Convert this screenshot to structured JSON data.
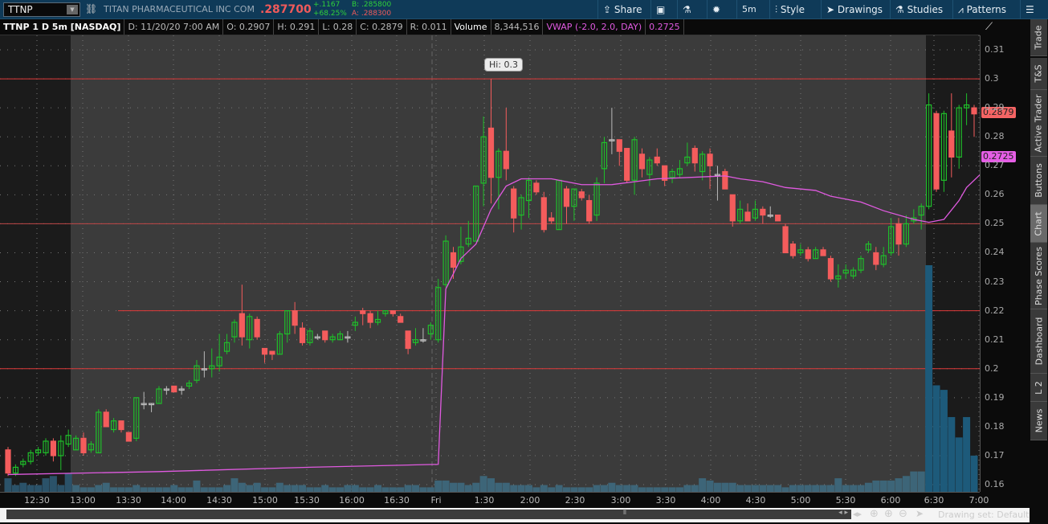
{
  "header": {
    "symbol": "TTNP",
    "company": "TITAN PHARMACEUTICAL INC COM",
    "last": ".287700",
    "change": "+.1167",
    "change_pct": "+68.25%",
    "bid": "B: .285800",
    "ask": "A: .288300",
    "buttons": {
      "share": "Share",
      "timeframe": "5m",
      "style": "Style",
      "drawings": "Drawings",
      "studies": "Studies",
      "patterns": "Patterns"
    }
  },
  "info": {
    "title": "TTNP 1 D 5m [NASDAQ]",
    "date": "D: 11/20/20 7:00 AM",
    "open": "O: 0.2907",
    "high": "H: 0.291",
    "low": "L: 0.28",
    "close": "C: 0.2879",
    "range": "R: 0.011",
    "volume_label": "Volume",
    "volume": "8,344,516",
    "vwap_label": "VWAP (-2.0, 2.0, DAY)",
    "vwap": "0.2725"
  },
  "price_tags": {
    "last": "0.2879",
    "vwap": "0.2725"
  },
  "hi_label": "Hi: 0.3",
  "sidebar": [
    "Trade",
    "T&S",
    "Active Trader",
    "Buttons",
    "Chart",
    "Phase Scores",
    "Dashboard",
    "L 2",
    "News"
  ],
  "sidebar_selected": "Chart",
  "footer": {
    "drawing_set": "Drawing set: Default"
  },
  "colors": {
    "up": "#1fbf2a",
    "down": "#f45c5c",
    "vwap": "#e05ae0",
    "level": "#e03a3a"
  },
  "chart_data": {
    "type": "candlestick",
    "symbol": "TTNP",
    "interval": "5m",
    "ylim": [
      0.155,
      0.3165
    ],
    "y_ticks": [
      "0.31",
      "0.3",
      "0.29",
      "0.28",
      "0.27",
      "0.26",
      "0.25",
      "0.24",
      "0.23",
      "0.22",
      "0.21",
      "0.2",
      "0.19",
      "0.18",
      "0.17",
      "0.16"
    ],
    "x_ticks": [
      "12:30",
      "13:00",
      "13:30",
      "14:00",
      "14:30",
      "15:00",
      "15:30",
      "16:00",
      "16:30",
      "Fri",
      "1:30",
      "2:00",
      "2:30",
      "3:00",
      "3:30",
      "4:00",
      "4:30",
      "5:00",
      "5:30",
      "6:00",
      "6:30",
      "7:00"
    ],
    "levels": [
      0.3,
      0.25,
      0.22,
      0.2
    ],
    "ohlc": [
      [
        0.172,
        0.173,
        0.163,
        0.164
      ],
      [
        0.164,
        0.167,
        0.163,
        0.166
      ],
      [
        0.167,
        0.169,
        0.166,
        0.168
      ],
      [
        0.168,
        0.172,
        0.167,
        0.171
      ],
      [
        0.171,
        0.173,
        0.17,
        0.172
      ],
      [
        0.171,
        0.176,
        0.17,
        0.175
      ],
      [
        0.175,
        0.176,
        0.168,
        0.17
      ],
      [
        0.17,
        0.177,
        0.165,
        0.175
      ],
      [
        0.174,
        0.179,
        0.173,
        0.177
      ],
      [
        0.172,
        0.177,
        0.172,
        0.176
      ],
      [
        0.176,
        0.178,
        0.17,
        0.171
      ],
      [
        0.172,
        0.175,
        0.171,
        0.174
      ],
      [
        0.171,
        0.186,
        0.171,
        0.185
      ],
      [
        0.185,
        0.186,
        0.18,
        0.18
      ],
      [
        0.179,
        0.183,
        0.178,
        0.182
      ],
      [
        0.182,
        0.182,
        0.178,
        0.179
      ],
      [
        0.178,
        0.178,
        0.175,
        0.175
      ],
      [
        0.176,
        0.19,
        0.175,
        0.19
      ],
      [
        0.188,
        0.192,
        0.186,
        0.188
      ],
      [
        0.188,
        0.188,
        0.185,
        0.188
      ],
      [
        0.188,
        0.194,
        0.188,
        0.193
      ],
      [
        0.193,
        0.194,
        0.191,
        0.193
      ],
      [
        0.194,
        0.194,
        0.192,
        0.192
      ],
      [
        0.193,
        0.194,
        0.191,
        0.193
      ],
      [
        0.194,
        0.196,
        0.193,
        0.195
      ],
      [
        0.196,
        0.203,
        0.195,
        0.201
      ],
      [
        0.2,
        0.206,
        0.197,
        0.2
      ],
      [
        0.2,
        0.207,
        0.197,
        0.201
      ],
      [
        0.201,
        0.212,
        0.199,
        0.204
      ],
      [
        0.206,
        0.212,
        0.205,
        0.209
      ],
      [
        0.211,
        0.217,
        0.209,
        0.216
      ],
      [
        0.219,
        0.229,
        0.208,
        0.211
      ],
      [
        0.21,
        0.219,
        0.207,
        0.218
      ],
      [
        0.217,
        0.218,
        0.21,
        0.211
      ],
      [
        0.207,
        0.207,
        0.202,
        0.205
      ],
      [
        0.206,
        0.206,
        0.203,
        0.205
      ],
      [
        0.205,
        0.213,
        0.205,
        0.212
      ],
      [
        0.212,
        0.22,
        0.209,
        0.22
      ],
      [
        0.22,
        0.223,
        0.212,
        0.215
      ],
      [
        0.214,
        0.216,
        0.208,
        0.209
      ],
      [
        0.209,
        0.214,
        0.208,
        0.213
      ],
      [
        0.211,
        0.212,
        0.21,
        0.211
      ],
      [
        0.213,
        0.213,
        0.209,
        0.21
      ],
      [
        0.21,
        0.212,
        0.209,
        0.211
      ],
      [
        0.21,
        0.213,
        0.21,
        0.212
      ],
      [
        0.211,
        0.213,
        0.209,
        0.211
      ],
      [
        0.215,
        0.218,
        0.213,
        0.216
      ],
      [
        0.22,
        0.221,
        0.215,
        0.219
      ],
      [
        0.219,
        0.22,
        0.214,
        0.216
      ],
      [
        0.216,
        0.22,
        0.215,
        0.217
      ],
      [
        0.219,
        0.22,
        0.218,
        0.22
      ],
      [
        0.22,
        0.22,
        0.218,
        0.219
      ],
      [
        0.218,
        0.219,
        0.216,
        0.216
      ],
      [
        0.213,
        0.213,
        0.205,
        0.207
      ],
      [
        0.209,
        0.214,
        0.208,
        0.21
      ],
      [
        0.21,
        0.214,
        0.209,
        0.21
      ],
      [
        0.212,
        0.216,
        0.21,
        0.215
      ],
      [
        0.21,
        0.231,
        0.209,
        0.228
      ],
      [
        0.229,
        0.246,
        0.228,
        0.244
      ],
      [
        0.24,
        0.242,
        0.231,
        0.235
      ],
      [
        0.237,
        0.249,
        0.236,
        0.242
      ],
      [
        0.243,
        0.251,
        0.242,
        0.245
      ],
      [
        0.244,
        0.263,
        0.244,
        0.263
      ],
      [
        0.264,
        0.287,
        0.256,
        0.28
      ],
      [
        0.283,
        0.3,
        0.257,
        0.266
      ],
      [
        0.266,
        0.276,
        0.255,
        0.275
      ],
      [
        0.275,
        0.29,
        0.265,
        0.269
      ],
      [
        0.262,
        0.263,
        0.247,
        0.252
      ],
      [
        0.253,
        0.26,
        0.248,
        0.259
      ],
      [
        0.258,
        0.266,
        0.252,
        0.265
      ],
      [
        0.264,
        0.265,
        0.26,
        0.261
      ],
      [
        0.259,
        0.261,
        0.247,
        0.248
      ],
      [
        0.252,
        0.254,
        0.25,
        0.251
      ],
      [
        0.248,
        0.265,
        0.248,
        0.265
      ],
      [
        0.262,
        0.263,
        0.25,
        0.256
      ],
      [
        0.256,
        0.262,
        0.251,
        0.262
      ],
      [
        0.261,
        0.262,
        0.258,
        0.259
      ],
      [
        0.258,
        0.26,
        0.25,
        0.251
      ],
      [
        0.253,
        0.266,
        0.251,
        0.264
      ],
      [
        0.269,
        0.28,
        0.264,
        0.278
      ],
      [
        0.279,
        0.29,
        0.274,
        0.279
      ],
      [
        0.279,
        0.279,
        0.27,
        0.275
      ],
      [
        0.276,
        0.276,
        0.264,
        0.265
      ],
      [
        0.265,
        0.28,
        0.26,
        0.279
      ],
      [
        0.274,
        0.276,
        0.266,
        0.269
      ],
      [
        0.267,
        0.273,
        0.263,
        0.272
      ],
      [
        0.273,
        0.276,
        0.27,
        0.271
      ],
      [
        0.27,
        0.27,
        0.263,
        0.265
      ],
      [
        0.266,
        0.269,
        0.264,
        0.268
      ],
      [
        0.267,
        0.272,
        0.266,
        0.269
      ],
      [
        0.271,
        0.278,
        0.27,
        0.273
      ],
      [
        0.276,
        0.277,
        0.268,
        0.271
      ],
      [
        0.268,
        0.275,
        0.265,
        0.274
      ],
      [
        0.274,
        0.276,
        0.262,
        0.27
      ],
      [
        0.267,
        0.27,
        0.258,
        0.267
      ],
      [
        0.268,
        0.269,
        0.262,
        0.262
      ],
      [
        0.26,
        0.26,
        0.249,
        0.251
      ],
      [
        0.251,
        0.258,
        0.25,
        0.255
      ],
      [
        0.254,
        0.257,
        0.251,
        0.251
      ],
      [
        0.252,
        0.258,
        0.251,
        0.255
      ],
      [
        0.255,
        0.256,
        0.25,
        0.253
      ],
      [
        0.253,
        0.256,
        0.252,
        0.253
      ],
      [
        0.253,
        0.253,
        0.251,
        0.251
      ],
      [
        0.249,
        0.25,
        0.24,
        0.24
      ],
      [
        0.243,
        0.244,
        0.238,
        0.239
      ],
      [
        0.24,
        0.243,
        0.239,
        0.241
      ],
      [
        0.241,
        0.242,
        0.237,
        0.238
      ],
      [
        0.238,
        0.242,
        0.238,
        0.241
      ],
      [
        0.241,
        0.242,
        0.239,
        0.239
      ],
      [
        0.238,
        0.239,
        0.23,
        0.231
      ],
      [
        0.231,
        0.236,
        0.228,
        0.232
      ],
      [
        0.233,
        0.236,
        0.231,
        0.234
      ],
      [
        0.232,
        0.235,
        0.231,
        0.234
      ],
      [
        0.234,
        0.239,
        0.233,
        0.238
      ],
      [
        0.241,
        0.244,
        0.24,
        0.243
      ],
      [
        0.24,
        0.242,
        0.234,
        0.236
      ],
      [
        0.236,
        0.242,
        0.235,
        0.239
      ],
      [
        0.24,
        0.252,
        0.239,
        0.249
      ],
      [
        0.25,
        0.252,
        0.239,
        0.243
      ],
      [
        0.243,
        0.253,
        0.242,
        0.25
      ],
      [
        0.251,
        0.255,
        0.25,
        0.252
      ],
      [
        0.253,
        0.257,
        0.248,
        0.256
      ],
      [
        0.256,
        0.295,
        0.255,
        0.291
      ],
      [
        0.288,
        0.289,
        0.261,
        0.262
      ],
      [
        0.265,
        0.289,
        0.261,
        0.288
      ],
      [
        0.282,
        0.295,
        0.266,
        0.273
      ],
      [
        0.273,
        0.291,
        0.269,
        0.29
      ],
      [
        0.29,
        0.295,
        0.284,
        0.291
      ],
      [
        0.29,
        0.291,
        0.28,
        0.2879
      ]
    ],
    "volume_relative": [
      6,
      3,
      4,
      3,
      3,
      6,
      7,
      3,
      8,
      3,
      2,
      2,
      3,
      4,
      2,
      2,
      2,
      3,
      2,
      2,
      2,
      2,
      3,
      2,
      2,
      5,
      2,
      2,
      2,
      3,
      6,
      4,
      3,
      4,
      2,
      2,
      4,
      3,
      3,
      3,
      2,
      2,
      3,
      2,
      2,
      3,
      3,
      2,
      2,
      3,
      2,
      2,
      2,
      3,
      3,
      2,
      2,
      5,
      5,
      4,
      4,
      3,
      4,
      7,
      6,
      4,
      4,
      3,
      3,
      3,
      2,
      3,
      2,
      3,
      2,
      2,
      2,
      2,
      3,
      3,
      4,
      3,
      3,
      3,
      2,
      2,
      2,
      2,
      2,
      2,
      3,
      3,
      6,
      5,
      4,
      4,
      4,
      3,
      3,
      3,
      3,
      3,
      3,
      2,
      3,
      3,
      3,
      3,
      3,
      3,
      6,
      3,
      3,
      3,
      4,
      5,
      5,
      5,
      6,
      7,
      9,
      9,
      100,
      47,
      45,
      33,
      24,
      33,
      16
    ],
    "vwap_points": [
      [
        0,
        0.1635
      ],
      [
        20,
        0.1645
      ],
      [
        40,
        0.166
      ],
      [
        57,
        0.167
      ],
      [
        58,
        0.2275
      ],
      [
        60,
        0.238
      ],
      [
        62,
        0.243
      ],
      [
        64,
        0.255
      ],
      [
        66,
        0.263
      ],
      [
        68,
        0.2655
      ],
      [
        72,
        0.2655
      ],
      [
        76,
        0.2635
      ],
      [
        80,
        0.2635
      ],
      [
        83,
        0.2645
      ],
      [
        86,
        0.2655
      ],
      [
        95,
        0.2665
      ],
      [
        97,
        0.2655
      ],
      [
        100,
        0.2645
      ],
      [
        103,
        0.2625
      ],
      [
        107,
        0.2615
      ],
      [
        109,
        0.2595
      ],
      [
        113,
        0.2575
      ],
      [
        116,
        0.2545
      ],
      [
        120,
        0.2515
      ],
      [
        122,
        0.2505
      ],
      [
        124,
        0.2515
      ],
      [
        126,
        0.258
      ],
      [
        127,
        0.2625
      ],
      [
        129,
        0.2675
      ],
      [
        132,
        0.2725
      ]
    ]
  }
}
